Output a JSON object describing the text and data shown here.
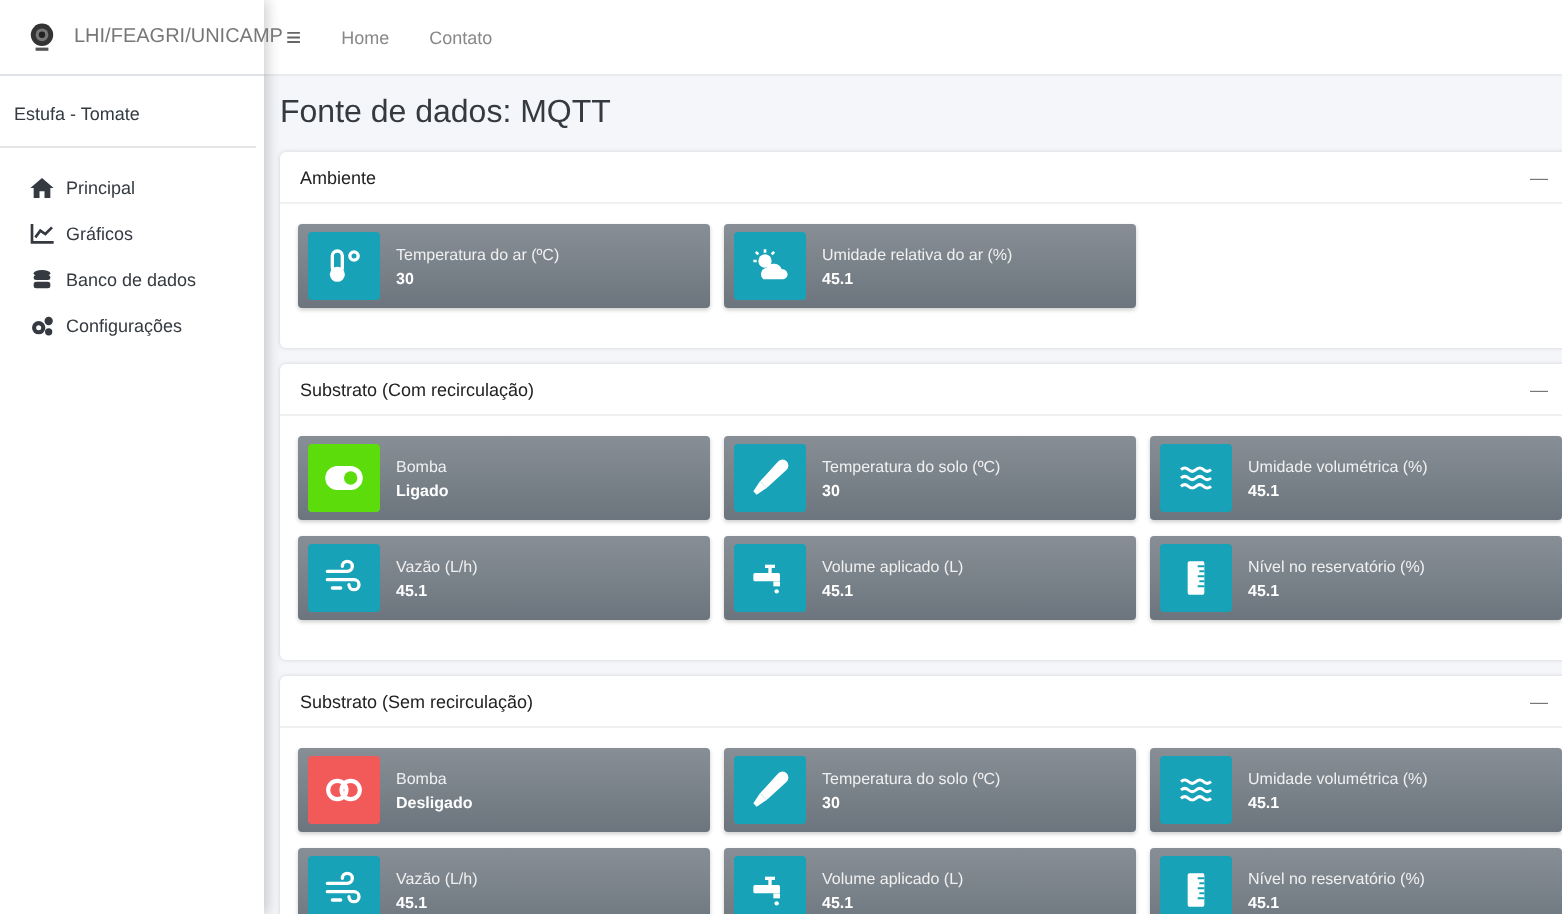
{
  "brand": {
    "name": "LHI/FEAGRI/UNICAMP"
  },
  "topnav": {
    "menu_icon": "≡",
    "links": [
      "Home",
      "Contato"
    ]
  },
  "sidebar": {
    "subtitle": "Estufa - Tomate",
    "items": [
      {
        "label": "Principal",
        "kind": "home"
      },
      {
        "label": "Gráficos",
        "kind": "chart"
      },
      {
        "label": "Banco de dados",
        "kind": "database"
      },
      {
        "label": "Configurações",
        "kind": "settings"
      }
    ]
  },
  "page_title": "Fonte de dados: MQTT",
  "cards": [
    {
      "title": "Ambiente",
      "collapse": "—",
      "boxes": [
        {
          "kind": "air_temperature",
          "label": "Temperatura do ar (ºC)",
          "value": "30"
        },
        {
          "kind": "air_humidity",
          "label": "Umidade relativa do ar (%)",
          "value": "45.1"
        }
      ]
    },
    {
      "title": "Substrato (Com recirculação)",
      "collapse": "—",
      "boxes": [
        {
          "kind": "pump",
          "on": true,
          "label": "Bomba",
          "value": "Ligado"
        },
        {
          "kind": "soil_temperature",
          "label": "Temperatura do solo (ºC)",
          "value": "30"
        },
        {
          "kind": "moisture",
          "label": "Umidade volumétrica (%)",
          "value": "45.1"
        },
        {
          "kind": "flow",
          "label": "Vazão (L/h)",
          "value": "45.1"
        },
        {
          "kind": "volume",
          "label": "Volume aplicado (L)",
          "value": "45.1"
        },
        {
          "kind": "level",
          "label": "Nível no reservatório (%)",
          "value": "45.1"
        }
      ]
    },
    {
      "title": "Substrato (Sem recirculação)",
      "collapse": "—",
      "boxes": [
        {
          "kind": "pump",
          "on": false,
          "label": "Bomba",
          "value": "Desligado"
        },
        {
          "kind": "soil_temperature",
          "label": "Temperatura do solo (ºC)",
          "value": "30"
        },
        {
          "kind": "moisture",
          "label": "Umidade volumétrica (%)",
          "value": "45.1"
        },
        {
          "kind": "flow",
          "label": "Vazão (L/h)",
          "value": "45.1"
        },
        {
          "kind": "volume",
          "label": "Volume aplicado (L)",
          "value": "45.1"
        },
        {
          "kind": "level",
          "label": "Nível no reservatório (%)",
          "value": "45.1"
        }
      ]
    }
  ]
}
